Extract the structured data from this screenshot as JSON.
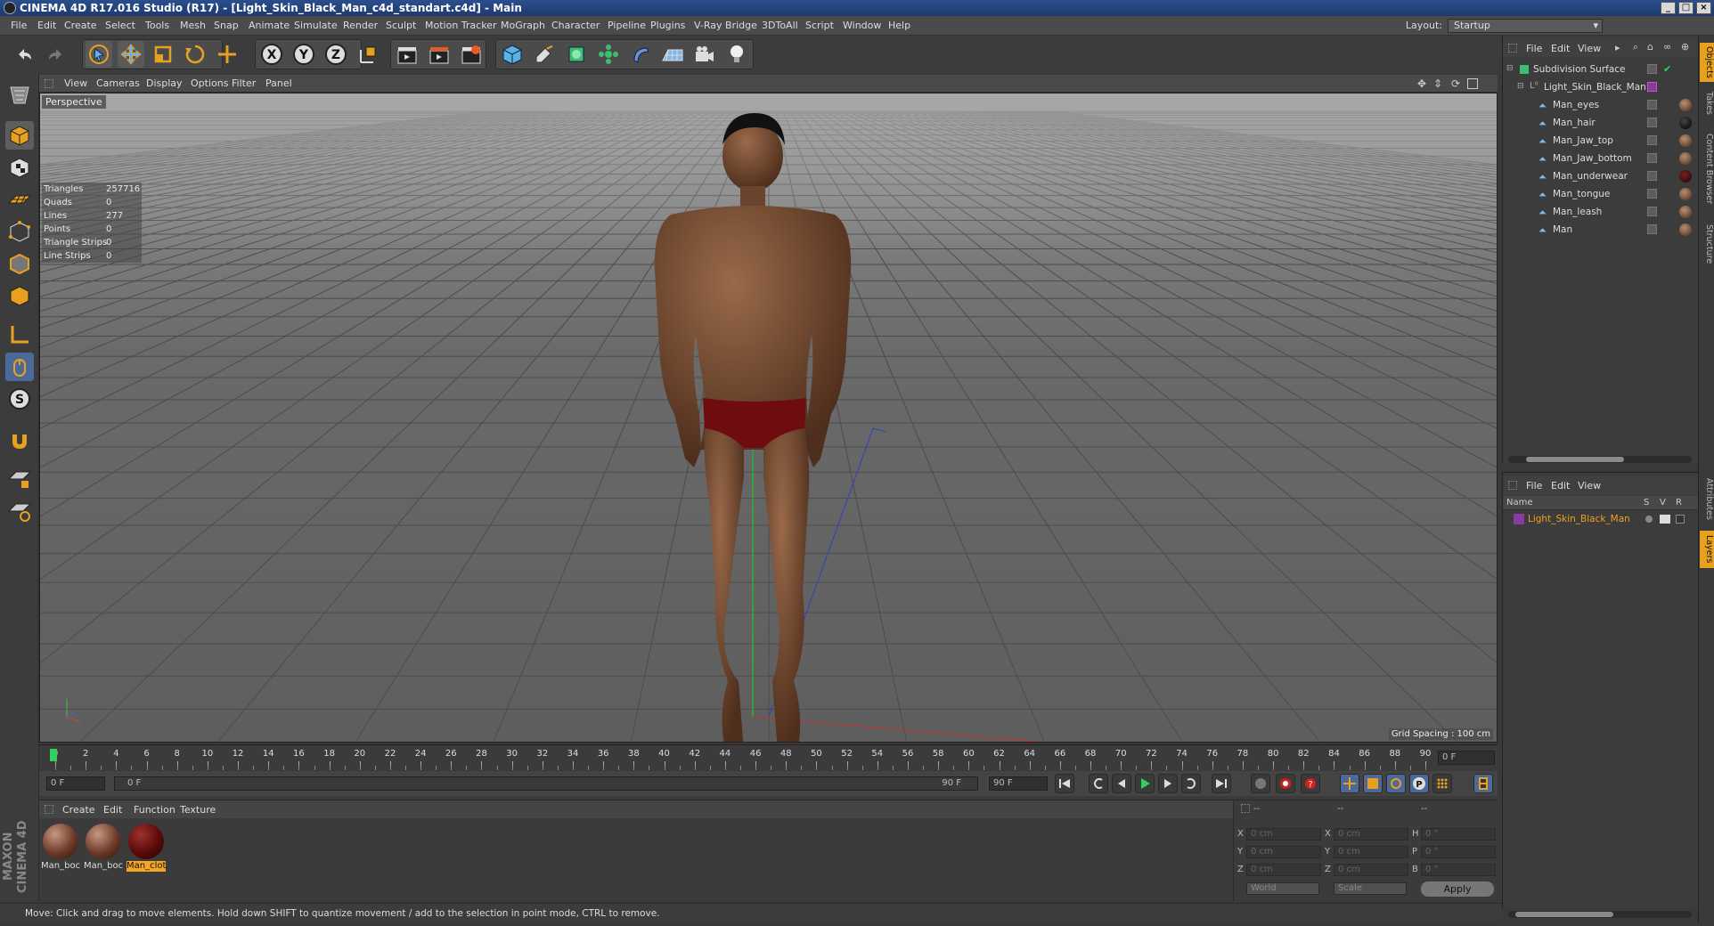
{
  "window": {
    "title": "CINEMA 4D R17.016 Studio (R17) - [Light_Skin_Black_Man_c4d_standart.c4d] - Main",
    "minimize": "_",
    "maximize": "□",
    "close": "×"
  },
  "menubar": {
    "items": [
      "File",
      "Edit",
      "Create",
      "Select",
      "Tools",
      "Mesh",
      "Snap",
      "Animate",
      "Simulate",
      "Render",
      "Sculpt",
      "Motion Tracker",
      "MoGraph",
      "Character",
      "Pipeline",
      "Plugins",
      "V-Ray Bridge",
      "3DToAll",
      "Script",
      "Window",
      "Help"
    ],
    "layout_label": "Layout:",
    "layout_value": "Startup"
  },
  "toolbar": {
    "axis_x": "X",
    "axis_y": "Y",
    "axis_z": "Z"
  },
  "viewport": {
    "menu": [
      "View",
      "Cameras",
      "Display",
      "Options",
      "Filter",
      "Panel"
    ],
    "perspective_label": "Perspective",
    "stats": [
      {
        "label": "Triangles",
        "value": "257716"
      },
      {
        "label": "Quads",
        "value": "0"
      },
      {
        "label": "Lines",
        "value": "277"
      },
      {
        "label": "Points",
        "value": "0"
      },
      {
        "label": "Triangle Strips",
        "value": "0"
      },
      {
        "label": "Line Strips",
        "value": "0"
      }
    ],
    "grid_spacing": "Grid Spacing : 100 cm"
  },
  "timeline": {
    "ticks": [
      "0",
      "2",
      "4",
      "6",
      "8",
      "10",
      "12",
      "14",
      "16",
      "18",
      "20",
      "22",
      "24",
      "26",
      "28",
      "30",
      "32",
      "34",
      "36",
      "38",
      "40",
      "42",
      "44",
      "46",
      "48",
      "50",
      "52",
      "54",
      "56",
      "58",
      "60",
      "62",
      "64",
      "66",
      "68",
      "70",
      "72",
      "74",
      "76",
      "78",
      "80",
      "82",
      "84",
      "86",
      "88",
      "90"
    ],
    "current_frame": "0 F",
    "start_field": "0 F",
    "range_start": "0 F",
    "range_end": "90 F",
    "end_field": "90 F"
  },
  "materials": {
    "menu": [
      "Create",
      "Edit",
      "Function",
      "Texture"
    ],
    "items": [
      {
        "label": "Man_boc",
        "color": "#6b3a2a",
        "selected": false
      },
      {
        "label": "Man_boc",
        "color": "#6b3a2a",
        "selected": false
      },
      {
        "label": "Man_clot",
        "color": "#5a0a0a",
        "selected": true
      }
    ]
  },
  "coordinates": {
    "header_dashes": [
      "--",
      "--",
      "--"
    ],
    "rows": [
      {
        "a_label": "X",
        "a_value": "0 cm",
        "b_label": "X",
        "b_value": "0 cm",
        "c_label": "H",
        "c_value": "0 °"
      },
      {
        "a_label": "Y",
        "a_value": "0 cm",
        "b_label": "Y",
        "b_value": "0 cm",
        "c_label": "P",
        "c_value": "0 °"
      },
      {
        "a_label": "Z",
        "a_value": "0 cm",
        "b_label": "Z",
        "b_value": "0 cm",
        "c_label": "B",
        "c_value": "0 °"
      }
    ],
    "world": "World",
    "scale": "Scale",
    "apply": "Apply"
  },
  "status": "Move: Click and drag to move elements. Hold down SHIFT to quantize movement / add to the selection in point mode, CTRL to remove.",
  "maxon": "MAXON CINEMA 4D",
  "objects": {
    "menu": [
      "File",
      "Edit",
      "View"
    ],
    "items": [
      {
        "name": "Subdivision Surface",
        "indent": 0
      },
      {
        "name": "Light_Skin_Black_Man",
        "indent": 1
      },
      {
        "name": "Man_eyes",
        "indent": 2
      },
      {
        "name": "Man_hair",
        "indent": 2
      },
      {
        "name": "Man_Jaw_top",
        "indent": 2
      },
      {
        "name": "Man_Jaw_bottom",
        "indent": 2
      },
      {
        "name": "Man_underwear",
        "indent": 2
      },
      {
        "name": "Man_tongue",
        "indent": 2
      },
      {
        "name": "Man_leash",
        "indent": 2
      },
      {
        "name": "Man",
        "indent": 2
      }
    ]
  },
  "layers": {
    "menu": [
      "File",
      "Edit",
      "View"
    ],
    "header_name": "Name",
    "header_cols": [
      "S",
      "V",
      "R"
    ],
    "items": [
      {
        "name": "Light_Skin_Black_Man",
        "color": "#8a3aa0"
      }
    ]
  },
  "side_tabs": [
    "Objects",
    "Takes",
    "Content Browser",
    "Structure",
    "Attributes",
    "Layers"
  ],
  "colors": {
    "accent": "#e8a020",
    "selected": "#f5a623",
    "layer_text": "#f0a020"
  }
}
